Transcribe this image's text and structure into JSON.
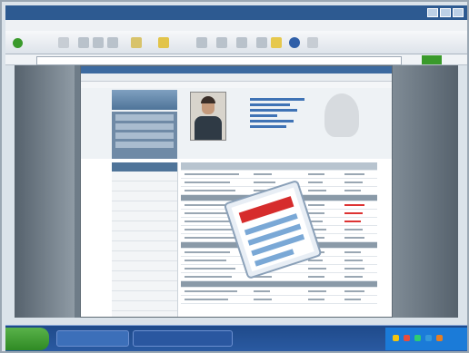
{
  "window": {
    "title": "",
    "menu": [
      "",
      "",
      "",
      "",
      "",
      ""
    ],
    "address": ""
  },
  "colors": {
    "accent": "#2d5a91",
    "doc_stripe": "#d62c2c",
    "doc_lines": "#7aa8d6",
    "go_green": "#3a9a2b"
  },
  "icons": {
    "document": "document-icon",
    "back": "back-arrow-icon"
  }
}
